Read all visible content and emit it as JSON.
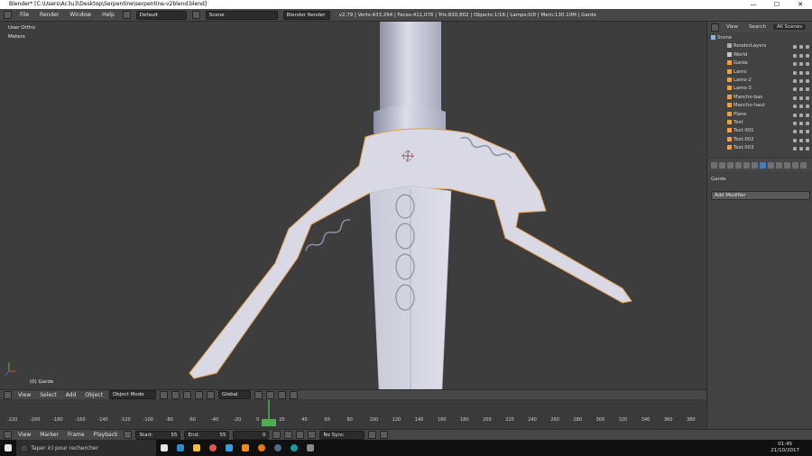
{
  "window": {
    "title": "Blender* [C:\\Users\\Ac3u3\\Desktop\\Serpentine\\serpentine-v2blend.blend]",
    "controls": [
      "—",
      "☐",
      "✕"
    ]
  },
  "infobar": {
    "menus": [
      "File",
      "Render",
      "Window",
      "Help"
    ],
    "layout": "Default",
    "scene": "Scene",
    "engine": "Blender Render",
    "stats": "v2.79 | Verts:433,294 | Faces:411,076 | Tris:820,802 | Objects:1/16 | Lamps:0/0 | Mem:130.10M | Garde"
  },
  "viewport": {
    "view_label": "User Ortho",
    "units_label": "Meters",
    "object_label": "(0) Garde"
  },
  "viewport_header": {
    "menus": [
      "View",
      "Select",
      "Add",
      "Object"
    ],
    "mode": "Object Mode",
    "orientation": "Global"
  },
  "timeline": {
    "ruler": [
      "-220",
      "-200",
      "-180",
      "-160",
      "-140",
      "-120",
      "-100",
      "-80",
      "-60",
      "-40",
      "-20",
      "0",
      "20",
      "40",
      "60",
      "80",
      "100",
      "120",
      "140",
      "160",
      "180",
      "200",
      "220",
      "240",
      "260",
      "280",
      "300",
      "320",
      "340",
      "360",
      "380"
    ],
    "current_frame_marker": "0"
  },
  "timeline_header": {
    "menus": [
      "View",
      "Marker",
      "Frame",
      "Playback"
    ],
    "start_label": "Start:",
    "start_value": "55",
    "end_label": "End:",
    "end_value": "55",
    "current": "0",
    "sync": "No Sync"
  },
  "outliner": {
    "tabs": [
      "View",
      "Search",
      "All Scenes"
    ],
    "items": [
      {
        "label": "Scene",
        "indent": 0,
        "icon": "scene-icon"
      },
      {
        "label": "RenderLayers",
        "indent": 1,
        "icon": "render-layers-icon"
      },
      {
        "label": "World",
        "indent": 1,
        "icon": "world-icon"
      },
      {
        "label": "Garde",
        "indent": 1,
        "icon": "mesh-icon"
      },
      {
        "label": "Lame",
        "indent": 1,
        "icon": "mesh-icon"
      },
      {
        "label": "Lame-2",
        "indent": 1,
        "icon": "mesh-icon"
      },
      {
        "label": "Lame-3",
        "indent": 1,
        "icon": "mesh-icon"
      },
      {
        "label": "Manche-bas",
        "indent": 1,
        "icon": "mesh-icon"
      },
      {
        "label": "Manche-haut",
        "indent": 1,
        "icon": "mesh-icon"
      },
      {
        "label": "Plane",
        "indent": 1,
        "icon": "mesh-icon"
      },
      {
        "label": "Text",
        "indent": 1,
        "icon": "text-icon"
      },
      {
        "label": "Text.001",
        "indent": 1,
        "icon": "text-icon"
      },
      {
        "label": "Text.002",
        "indent": 1,
        "icon": "text-icon"
      },
      {
        "label": "Text.003",
        "indent": 1,
        "icon": "text-icon"
      }
    ]
  },
  "properties": {
    "object_name": "Garde",
    "add_modifier": "Add Modifier"
  },
  "taskbar": {
    "search_placeholder": "Taper ici pour rechercher",
    "time": "01:45",
    "date": "21/10/2017"
  },
  "colors": {
    "selection": "#f5a623",
    "frame_marker": "#4caf50",
    "mesh": "#d8d8e8"
  }
}
